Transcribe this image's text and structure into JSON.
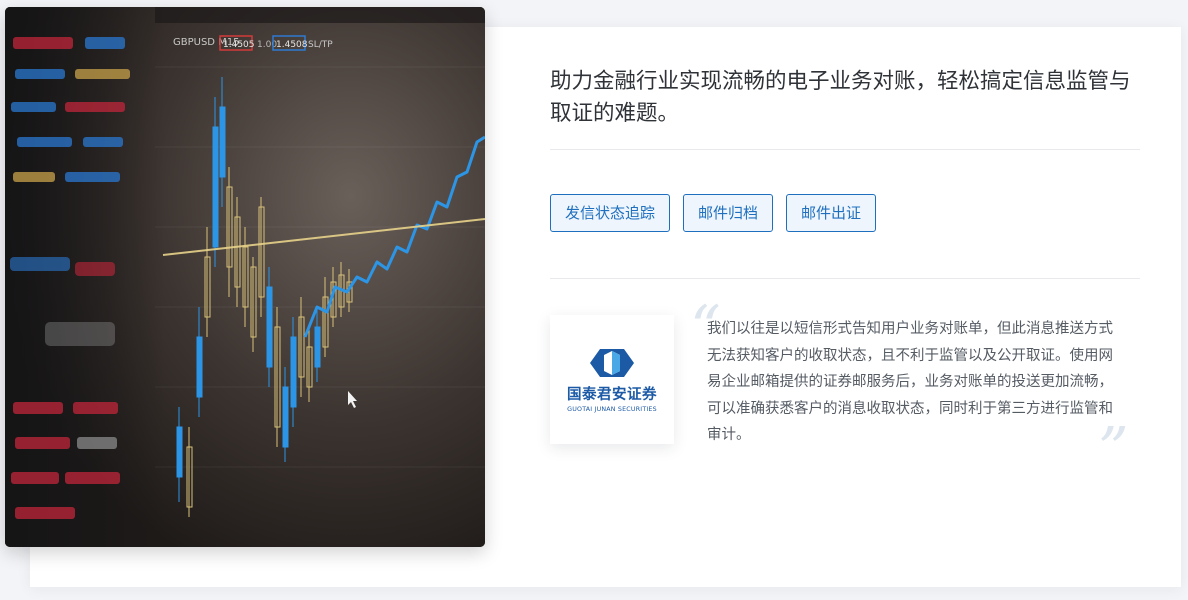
{
  "headline": "助力金融行业实现流畅的电子业务对账，轻松搞定信息监管与取证的难题。",
  "tags": [
    "发信状态追踪",
    "邮件归档",
    "邮件出证"
  ],
  "testimonial": {
    "text": "我们以往是以短信形式告知用户业务对账单，但此消息推送方式无法获知客户的收取状态，且不利于监管以及公开取证。使用网易企业邮箱提供的证券邮服务后，业务对账单的投送更加流畅，可以准确获悉客户的消息收取状态，同时利于第三方进行监管和审计。",
    "open_quote": "“",
    "close_quote": "”"
  },
  "logo": {
    "name_cn": "国泰君安证券",
    "name_en": "GUOTAI JUNAN SECURITIES",
    "icon": "guotai-junan-logo-icon"
  },
  "hero_image": {
    "icon": "stock-chart-photo",
    "ticker_label": "GBPUSD M15",
    "quote_left": "1.4505",
    "quote_mid": "1.00",
    "quote_right": "1.4508",
    "menu_label": "SL/TP"
  },
  "colors": {
    "accent": "#1f6fbf",
    "tag_bg": "#eef5fc",
    "text_main": "#2f3338",
    "text_body": "#555b63"
  }
}
